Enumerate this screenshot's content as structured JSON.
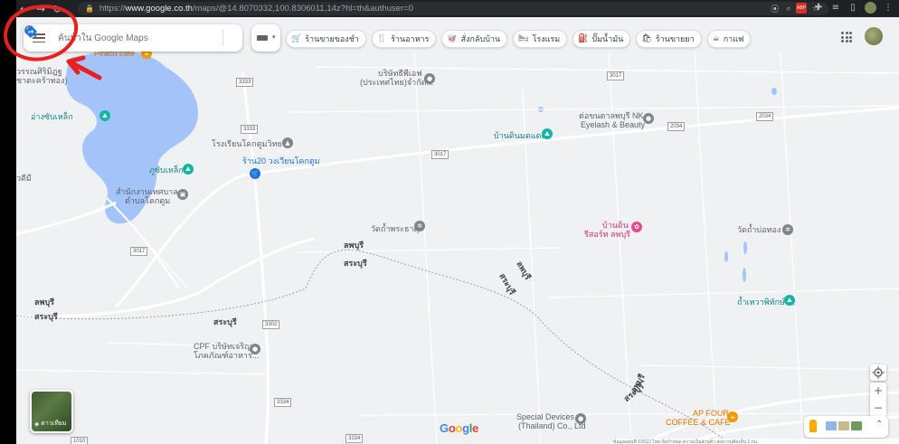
{
  "browser": {
    "back": "←",
    "forward": "→",
    "reload": "↻",
    "url_prefix": "https://",
    "url_host": "www.google.co.th",
    "url_path": "/maps/@14.8070332,100.8306011,14z?hl=th&authuser=0",
    "ext_badge": "ABP"
  },
  "maps": {
    "search_placeholder": "ค้นหาใน Google Maps",
    "chips": [
      {
        "icon": "🛒",
        "label": "ร้านขายของชำ"
      },
      {
        "icon": "🍴",
        "label": "ร้านอาหาร"
      },
      {
        "icon": "🥡",
        "label": "สั่งกลับบ้าน"
      },
      {
        "icon": "🛏",
        "label": "โรงแรม"
      },
      {
        "icon": "⛽",
        "label": "ปั๊มน้ำมัน"
      },
      {
        "icon": "🛍",
        "label": "ร้านขายยา"
      },
      {
        "icon": "☕",
        "label": "กาแฟ"
      }
    ],
    "labels": {
      "piracu": "Piracu cafe",
      "wat1a": "วรรณศิริมิฎฐ",
      "wat1b": "ชาตะคร้าทอง)",
      "bridge1": "บริษัทธีพีเอฟ",
      "bridge2": "(ประเทศไทย)จำกัด...",
      "ang": "อ่างซับเหล็ก",
      "school": "โรงเรียนโคกตูมวิทยา",
      "shop20": "ร้าน20 วงเวียนโคกตูม",
      "subl": "ภูซับเหล็ก",
      "admin1": "สำนักงานเทศบาล",
      "admin2": "ตำบลโคกตูม",
      "lbn1": "บ้านดินมดแดง",
      "nk1": "ต่อขนตาลพบุรี NK.",
      "nk2": "Eyelash & Beauty",
      "watkhao": "วัดถ้ำพระธาตุ",
      "bandin1": "บ้านดิน",
      "bandin2": "รีสอร์ท ลพบุรี",
      "watbo": "วัดถ้ำบ่อทอง",
      "cave": "ถ้ำเทวาพิทักษ์",
      "lop1": "ลพบุรี",
      "sara1": "สระบุรี",
      "lop2": "ลพบุรี",
      "sara2": "สระบุรี",
      "lop3": "ลพบุรี",
      "sara3": "สระบุรี",
      "sara4": "สระบุรี",
      "lop5": "ลพบุรี",
      "sara5": "สระบุรี",
      "cpf1": "CPF บริษัทเจริญ",
      "cpf2": "โภคภัณฑ์อาหาร...",
      "sd1": "Special Devices",
      "sd2": "(Thailand) Co., Ltd",
      "ap1": "AP FOUR",
      "ap2": "COFFEE & CAFE",
      "small_left": "วดีมี"
    },
    "roads": {
      "r3333a": "3333",
      "r3333b": "3333",
      "r3017a": "3017",
      "r3017b": "3017",
      "r3017c": "3017",
      "r2034a": "2034",
      "r2034b": "2034",
      "r3302": "3302",
      "r3334a": "3334",
      "r3334b": "3334",
      "r1010": "1010"
    },
    "satellite_label": "ดาวเทียม",
    "google_logo": "Google",
    "footer": "ข้อมูลแผนที่ ©2022   ไทย   ข้อกำหนด   ความเป็นส่วนตัว   ส่งความคิดเห็น   1 กม."
  },
  "colors": {
    "annotation": "#e8211e",
    "water": "#a4c4f9",
    "map_bg": "#f0f1f3"
  }
}
